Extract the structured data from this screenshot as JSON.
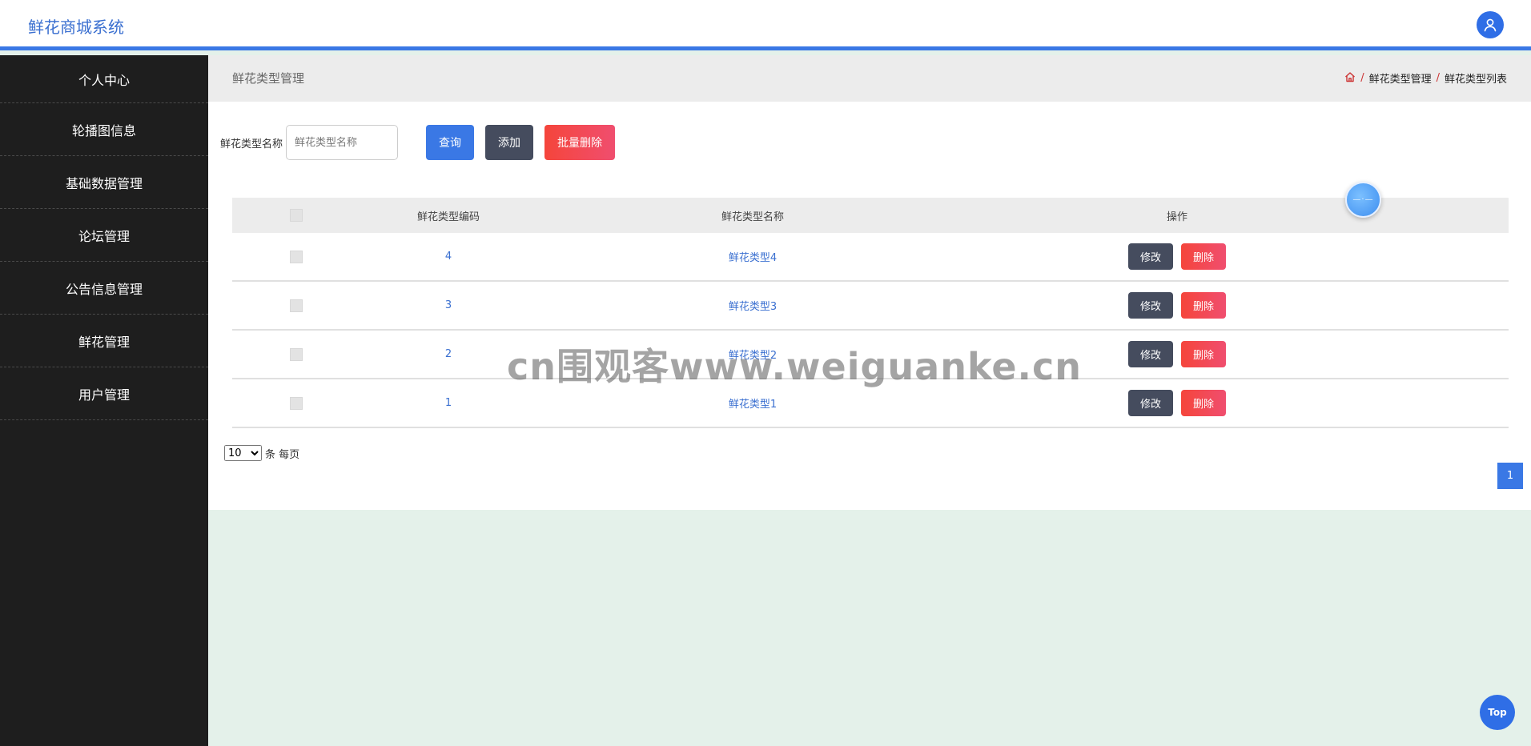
{
  "app": {
    "title": "鲜花商城系统"
  },
  "sidebar": {
    "items": [
      {
        "label": "个人中心"
      },
      {
        "label": "轮播图信息"
      },
      {
        "label": "基础数据管理"
      },
      {
        "label": "论坛管理"
      },
      {
        "label": "公告信息管理"
      },
      {
        "label": "鲜花管理"
      },
      {
        "label": "用户管理"
      }
    ]
  },
  "page": {
    "title": "鲜花类型管理",
    "breadcrumb": [
      "鲜花类型管理",
      "鲜花类型列表"
    ]
  },
  "search": {
    "label": "鲜花类型名称",
    "placeholder": "鲜花类型名称",
    "query_label": "查询",
    "add_label": "添加",
    "batch_delete_label": "批量删除"
  },
  "table": {
    "columns": [
      "鲜花类型编码",
      "鲜花类型名称",
      "操作"
    ],
    "rows": [
      {
        "code": "4",
        "name": "鲜花类型4"
      },
      {
        "code": "3",
        "name": "鲜花类型3"
      },
      {
        "code": "2",
        "name": "鲜花类型2"
      },
      {
        "code": "1",
        "name": "鲜花类型1"
      }
    ],
    "edit_label": "修改",
    "delete_label": "删除"
  },
  "pagination": {
    "page_size": "10",
    "page_size_suffix": "条 每页",
    "current_page": "1"
  },
  "watermark": "cn围观客www.weiguanke.cn",
  "top_button": "Top",
  "colors": {
    "primary": "#3a78e5",
    "danger": "#f5453b",
    "sidebar": "#1e1e1e",
    "dark_button": "#454c5e"
  }
}
